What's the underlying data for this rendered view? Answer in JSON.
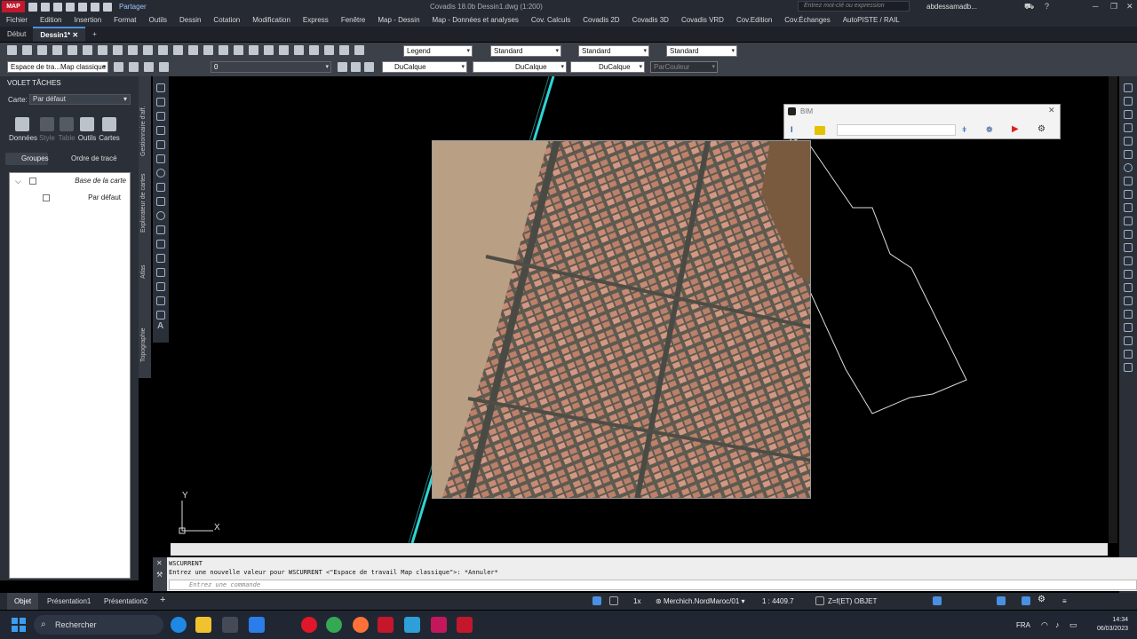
{
  "app": {
    "badge": "MAP",
    "title": "Covadis 18.0b    Dessin1.dwg (1:200)",
    "share_label": "Partager",
    "search_placeholder": "Entrez mot-clé ou expression",
    "user": "abdessamadb..."
  },
  "menu": [
    "Fichier",
    "Edition",
    "Insertion",
    "Format",
    "Outils",
    "Dessin",
    "Cotation",
    "Modification",
    "Express",
    "Fenêtre",
    "Map - Dessin",
    "Map - Données et analyses",
    "Cov. Calculs",
    "Covadis 2D",
    "Covadis 3D",
    "Covadis VRD",
    "Cov.Edition",
    "Cov.Échanges",
    "AutoPISTE / RAIL"
  ],
  "doc_tabs": [
    {
      "label": "Début",
      "active": false
    },
    {
      "label": "Dessin1*",
      "active": true
    }
  ],
  "toolbar1": {
    "annot_style": "Legend",
    "dim_style": "Standard",
    "table_style": "Standard",
    "mleader_style": "Standard"
  },
  "toolbar2": {
    "workspace": "Espace de tra...Map classique",
    "layer": "0",
    "color": "DuCalque",
    "linetype": "DuCalque",
    "lineweight": "DuCalque",
    "plotstyle": "ParCouleur"
  },
  "taskpane": {
    "header": "VOLET TÂCHES",
    "carte_label": "Carte:",
    "carte_value": "Par défaut",
    "buttons": [
      {
        "label": "Données",
        "enabled": true
      },
      {
        "label": "Style",
        "enabled": false
      },
      {
        "label": "Table",
        "enabled": false
      },
      {
        "label": "Outils",
        "enabled": true
      },
      {
        "label": "Cartes",
        "enabled": true
      }
    ],
    "groups_label": "Groupes",
    "order_label": "Ordre de tracé",
    "tree": {
      "root": "Base de la carte",
      "child": "Par défaut"
    },
    "side_tabs": [
      "Gestionnaire d'aff.",
      "Explorateur de cartes",
      "Atlas",
      "Topographie"
    ]
  },
  "bim": {
    "title": "BIM"
  },
  "command": {
    "line1": "WSCURRENT",
    "line2": "Entrez une nouvelle valeur pour WSCURRENT <\"Espace de travail Map classique\">: *Annuler*",
    "placeholder": "Entrez une commande"
  },
  "layout_tabs": [
    {
      "label": "Objet",
      "active": true
    },
    {
      "label": "Présentation1",
      "active": false
    },
    {
      "label": "Présentation2",
      "active": false
    }
  ],
  "status": {
    "scale_annot": "1x",
    "coord_system": "Merchich.NordMaroc/01",
    "scale": "1 : 4409.7",
    "zfet": "Z=f(ET) OBJET"
  },
  "taskbar": {
    "search": "Rechercher",
    "lang": "FRA",
    "time": "14:34",
    "date": "06/03/2023"
  },
  "ucs": {
    "x": "X",
    "y": "Y"
  }
}
